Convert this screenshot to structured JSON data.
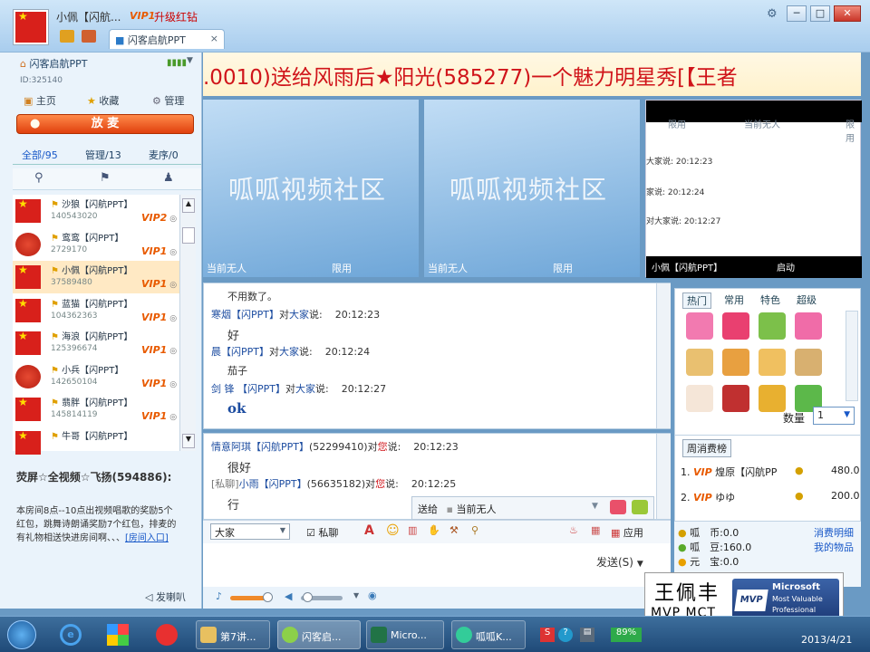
{
  "title_bar": {
    "username": "小佩【闪航...",
    "vip_badge": "VIP1",
    "upgrade_label": "升级红钻",
    "tab_label": "闪客启航PPT",
    "tab_close": "×",
    "buttons": {
      "skin": "⚙",
      "minimize": "─",
      "maximize": "□",
      "close": "✕"
    }
  },
  "room": {
    "name": "闪客启航PPT",
    "id_text": "ID:325140",
    "signal": "▮▮▮▮",
    "links": {
      "home": "主页",
      "favorite": "收藏",
      "manage": "管理"
    },
    "mic_button": "放 麦"
  },
  "user_tabs": {
    "all": "全部/95",
    "admin": "管理/13",
    "queue": "麦序/0"
  },
  "users": [
    {
      "name": "沙狼【闪航PPT】",
      "id": "140543020",
      "vip": "VIP2",
      "flag": "china"
    },
    {
      "name": "鸾鸾【闪PPT】",
      "id": "2729170",
      "vip": "VIP1",
      "flag": "emblem"
    },
    {
      "name": "小佩【闪航PPT】",
      "id": "37589480",
      "vip": "VIP1",
      "flag": "china",
      "selected": true
    },
    {
      "name": "蓝猫【闪航PPT】",
      "id": "104362363",
      "vip": "VIP1",
      "flag": "china"
    },
    {
      "name": "海浪【闪航PPT】",
      "id": "125396674",
      "vip": "VIP1",
      "flag": "china"
    },
    {
      "name": "小兵【闪PPT】",
      "id": "142650104",
      "vip": "VIP1",
      "flag": "emblem"
    },
    {
      "name": "翡胖【闪航PPT】",
      "id": "145814119",
      "vip": "VIP1",
      "flag": "china"
    },
    {
      "name": "牛哥【闪航PPT】",
      "id": "",
      "vip": "",
      "flag": "china"
    }
  ],
  "notice": {
    "title": "荧屏☆全视频☆飞扬(594886):",
    "body": "本房间8点--10点出视频唱歌的奖励5个红包，跳舞诗朗诵奖励7个红包，排麦的有礼物相送快进房间啊、、、",
    "link": "[房间入口]"
  },
  "speaker_label": "发喇叭",
  "marquee": ".0010)送给风雨后★阳光(585277)一个魅力明星秀[【王者",
  "videos": [
    {
      "logo": "呱呱视频社区",
      "status": "当前无人",
      "limit": "限用"
    },
    {
      "logo": "呱呱视频社区",
      "status": "当前无人",
      "limit": "限用"
    }
  ],
  "mini_panel": {
    "top_left": "限用",
    "top_right": "当前无人",
    "top_far": "限用",
    "lines": [
      "大家说: 20:12:23",
      "家说: 20:12:24",
      "对大家说: 20:12:27"
    ],
    "bottom_left": "小佩【闪航PPT】",
    "bottom_right": "启动"
  },
  "chat_public": [
    {
      "type": "text",
      "text": "不用数了。"
    },
    {
      "type": "head",
      "name": "寒烟【闪PPT】",
      "mid": "对",
      "target": "大家",
      "suffix": "说:",
      "time": "20:12:23"
    },
    {
      "type": "body",
      "text": "好"
    },
    {
      "type": "head",
      "name": "晨【闪PPT】",
      "mid": "对",
      "target": "大家",
      "suffix": "说:",
      "time": "20:12:24"
    },
    {
      "type": "text",
      "text": "茄子"
    },
    {
      "type": "head",
      "name": "剑 锋 【闪PPT】",
      "mid": "对",
      "target": "大家",
      "suffix": "说:",
      "time": "20:12:27"
    },
    {
      "type": "body",
      "text": "ok"
    }
  ],
  "chat_private": [
    {
      "type": "head",
      "prefix": "",
      "name": "情意阿琪【闪航PPT】",
      "mid": "(52299410)对",
      "target": "您",
      "suffix": "说:",
      "time": "20:12:23"
    },
    {
      "type": "body",
      "text": "很好"
    },
    {
      "type": "head",
      "prefix": "[私聊]",
      "name": "小雨【闪PPT】",
      "mid": "(56635182)对",
      "target": "您",
      "suffix": "说:",
      "time": "20:12:25"
    },
    {
      "type": "body",
      "text": "行"
    }
  ],
  "send_to": {
    "label": "送给",
    "value": "当前无人"
  },
  "toolbar": {
    "target": "大家",
    "private": "私聊",
    "apply": "应用"
  },
  "send_button": "发送(S)",
  "gift_tabs": [
    "热门",
    "常用",
    "特色",
    "超级"
  ],
  "quantity": {
    "label": "数量",
    "value": "1"
  },
  "rank": {
    "title": "周消费榜",
    "rows": [
      {
        "n": "1.",
        "vip": "VIP",
        "name": "煌原【闪航PP",
        "amount": "480.0"
      },
      {
        "n": "2.",
        "vip": "VIP",
        "name": "ゆゆ",
        "amount": "200.0"
      }
    ]
  },
  "currency": {
    "coin": "呱　币:0.0",
    "bean": "呱　豆:160.0",
    "yuan": "元　宝:0.0",
    "detail_link": "消费明细",
    "items_link": "我的物品"
  },
  "mvp": {
    "name": "王佩丰",
    "sub": "MVP  MCT",
    "badge_top": "Microsoft",
    "badge_mid": "Most Valuable",
    "badge_bottom": "Professional",
    "mark": "MVP"
  },
  "taskbar": {
    "items": [
      "第7讲...",
      "闪客启...",
      "Micro...",
      "呱呱K..."
    ],
    "battery": "89%",
    "date": "2013/4/21"
  }
}
